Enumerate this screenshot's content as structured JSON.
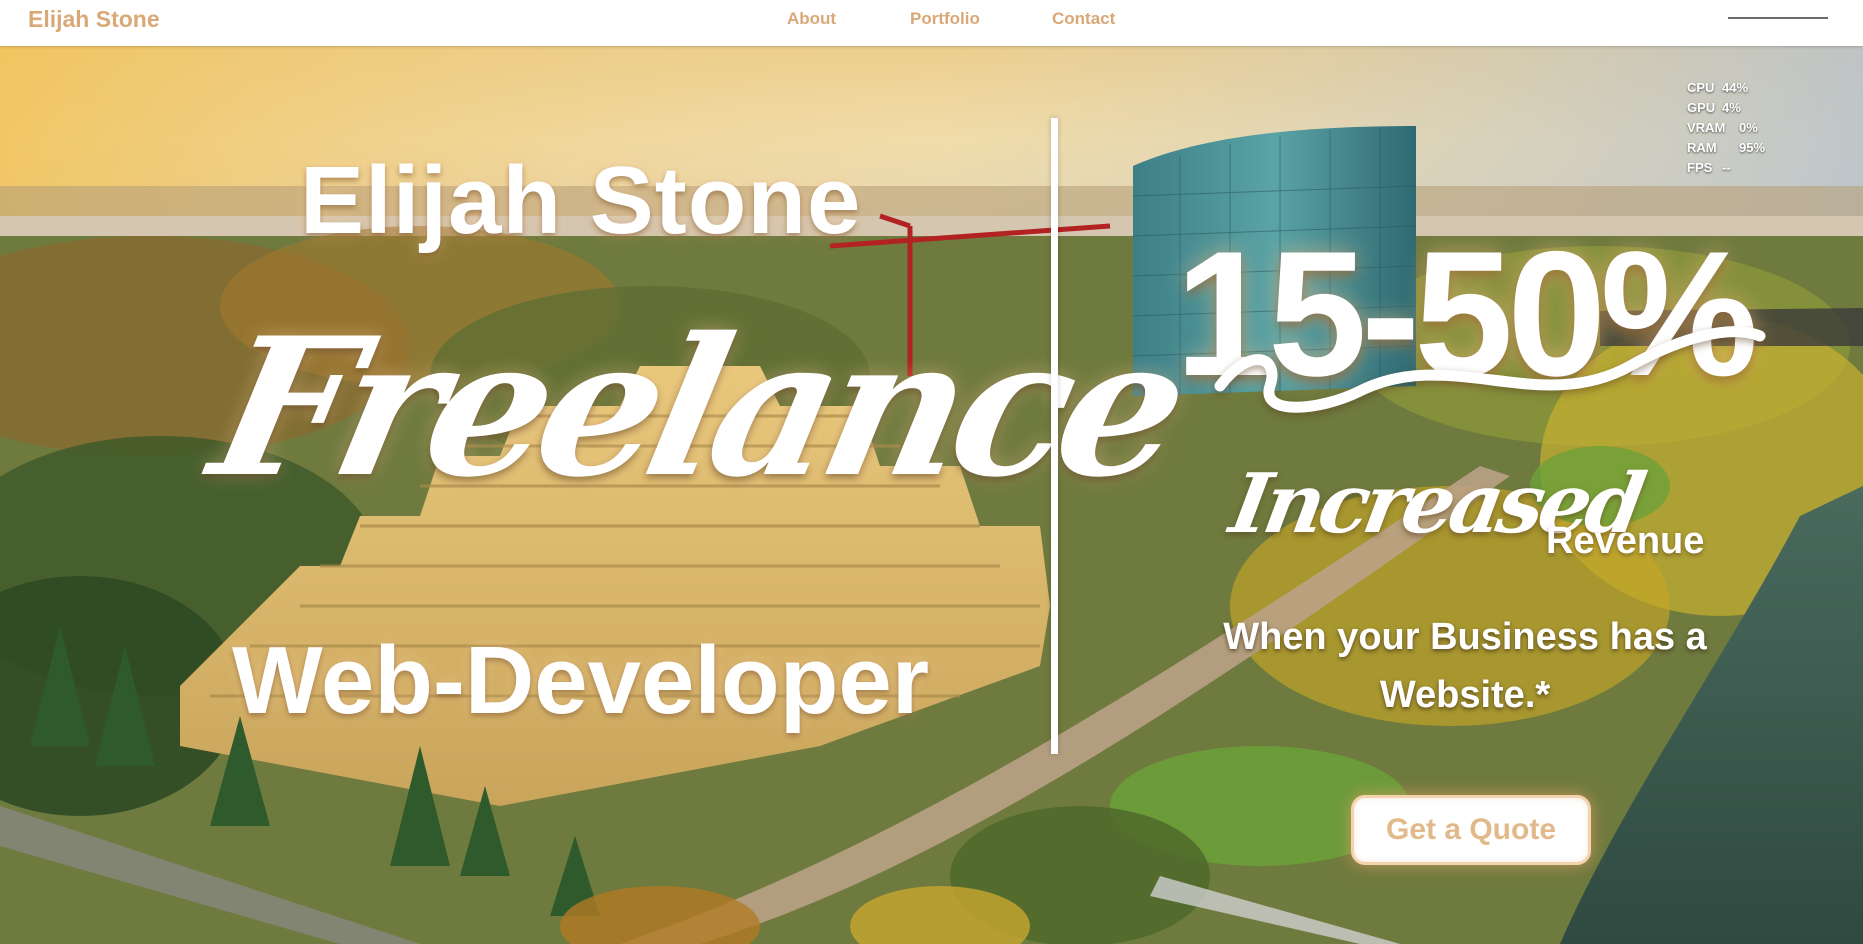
{
  "nav": {
    "brand": "Elijah Stone",
    "links": [
      "About",
      "Portfolio",
      "Contact"
    ]
  },
  "hero": {
    "name": "Elijah Stone",
    "script_word": "Freelance",
    "role": "Web-Developer",
    "stat": "15-50%",
    "stat_script": "Increased",
    "stat_word": "Revenue",
    "subtext": "When your Business has a Website.*",
    "cta": "Get a Quote"
  },
  "perf_overlay": {
    "rows": [
      {
        "label": "CPU",
        "value": "44%"
      },
      {
        "label": "GPU",
        "value": "4%"
      },
      {
        "label": "VRAM",
        "value": "0%"
      },
      {
        "label": "RAM",
        "value": "95%"
      },
      {
        "label": "FPS",
        "value": "--"
      }
    ]
  },
  "colors": {
    "accent": "#d9a877",
    "button_text": "#e2b98a",
    "text_light": "#ffffff"
  }
}
